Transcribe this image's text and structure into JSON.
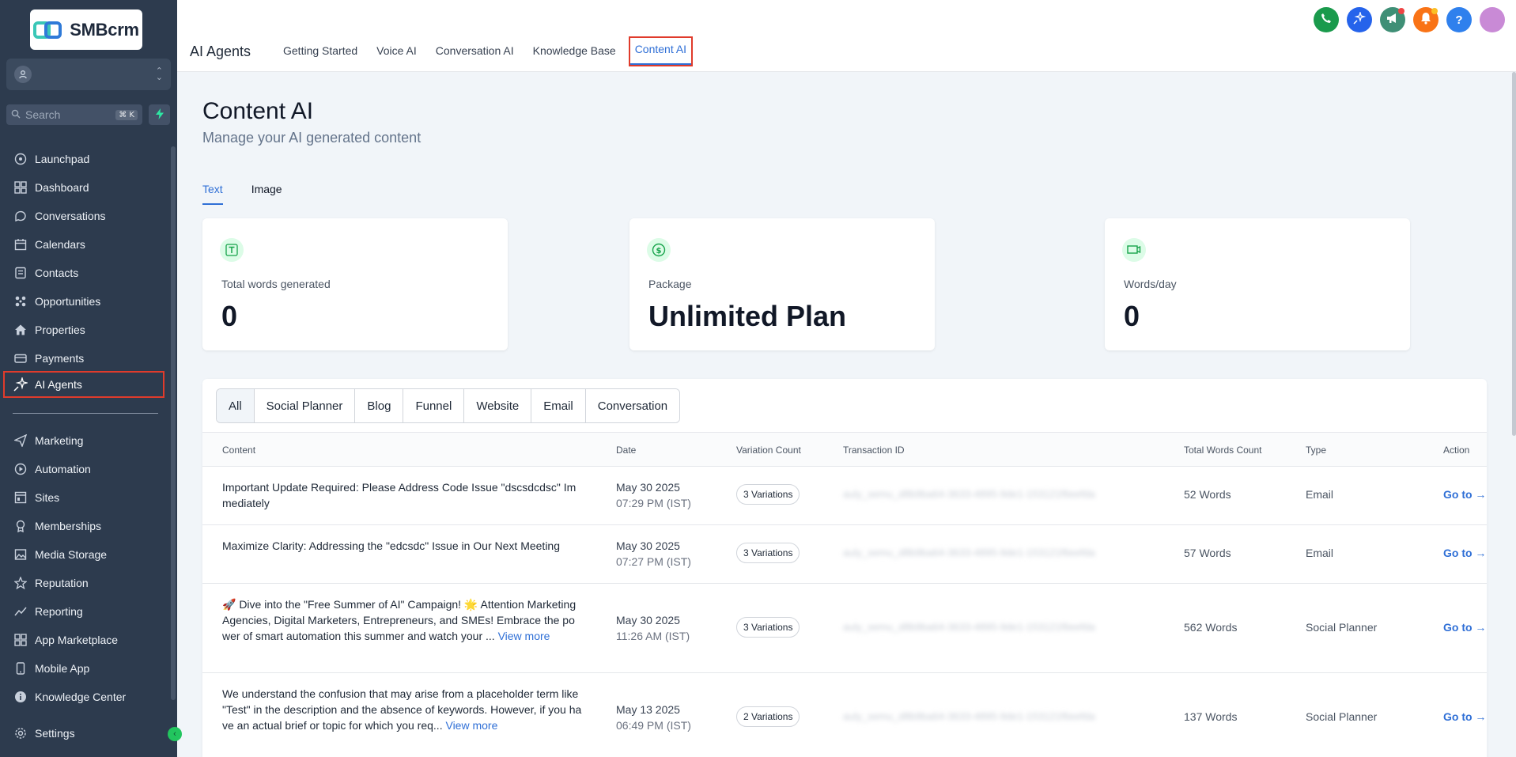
{
  "brand": {
    "name": "SMBcrm"
  },
  "sidebar": {
    "search_placeholder": "Search",
    "search_shortcut": "⌘ K",
    "items": [
      {
        "label": "Launchpad",
        "icon": "launchpad-icon"
      },
      {
        "label": "Dashboard",
        "icon": "dashboard-icon"
      },
      {
        "label": "Conversations",
        "icon": "chat-icon"
      },
      {
        "label": "Calendars",
        "icon": "calendar-icon"
      },
      {
        "label": "Contacts",
        "icon": "contacts-icon"
      },
      {
        "label": "Opportunities",
        "icon": "opportunities-icon"
      },
      {
        "label": "Properties",
        "icon": "home-icon"
      },
      {
        "label": "Payments",
        "icon": "payments-icon"
      },
      {
        "label": "AI Agents",
        "icon": "sparkle-icon"
      }
    ],
    "items2": [
      {
        "label": "Marketing",
        "icon": "send-icon"
      },
      {
        "label": "Automation",
        "icon": "automation-icon"
      },
      {
        "label": "Sites",
        "icon": "sites-icon"
      },
      {
        "label": "Memberships",
        "icon": "memberships-icon"
      },
      {
        "label": "Media Storage",
        "icon": "image-icon"
      },
      {
        "label": "Reputation",
        "icon": "star-icon"
      },
      {
        "label": "Reporting",
        "icon": "trend-icon"
      },
      {
        "label": "App Marketplace",
        "icon": "grid-icon"
      },
      {
        "label": "Mobile App",
        "icon": "mobile-icon"
      },
      {
        "label": "Knowledge Center",
        "icon": "info-icon"
      }
    ],
    "settings_label": "Settings"
  },
  "header": {
    "title": "AI Agents",
    "tabs": [
      "Getting Started",
      "Voice AI",
      "Conversation AI",
      "Knowledge Base",
      "Content AI"
    ],
    "active_tab": "Content AI"
  },
  "page": {
    "title": "Content AI",
    "subtitle": "Manage your AI generated content",
    "subtabs": [
      "Text",
      "Image"
    ],
    "active_subtab": "Text"
  },
  "stats": [
    {
      "label": "Total words generated",
      "value": "0",
      "icon": "text-icon"
    },
    {
      "label": "Package",
      "value": "Unlimited Plan",
      "icon": "dollar-icon"
    },
    {
      "label": "Words/day",
      "value": "0",
      "icon": "gauge-icon"
    }
  ],
  "filters": [
    "All",
    "Social Planner",
    "Blog",
    "Funnel",
    "Website",
    "Email",
    "Conversation"
  ],
  "active_filter": "All",
  "table": {
    "columns": [
      "Content",
      "Date",
      "Variation Count",
      "Transaction ID",
      "Total Words Count",
      "Type",
      "Action"
    ],
    "rows": [
      {
        "content": "Important Update Required: Please Address Code Issue \"dscsdcdsc\" Immediately",
        "view_more": "",
        "date": "May 30 2025",
        "time": "07:29 PM (IST)",
        "variations": "3 Variations",
        "txn": "auly_semu_d8b9ba64-3633-4895-9de1-153121f6eefda",
        "words": "52 Words",
        "type": "Email",
        "action": "Go to →"
      },
      {
        "content": "Maximize Clarity: Addressing the \"edcsdc\" Issue in Our Next Meeting",
        "view_more": "",
        "date": "May 30 2025",
        "time": "07:27 PM (IST)",
        "variations": "3 Variations",
        "txn": "auly_semu_d8b9ba64-3633-4895-9de1-153121f6eefda",
        "words": "57 Words",
        "type": "Email",
        "action": "Go to →"
      },
      {
        "content": "🚀 Dive into the \"Free Summer of AI\" Campaign! 🌟 Attention Marketing Agencies, Digital Marketers, Entrepreneurs, and SMEs! Embrace the power of smart automation this summer and watch your ... ",
        "view_more": "View more",
        "date": "May 30 2025",
        "time": "11:26 AM (IST)",
        "variations": "3 Variations",
        "txn": "auly_semu_d8b9ba64-3633-4895-9de1-153121f6eefda",
        "words": "562 Words",
        "type": "Social Planner",
        "action": "Go to →"
      },
      {
        "content": "We understand the confusion that may arise from a placeholder term like \"Test\" in the description and the absence of keywords. However, if you have an actual brief or topic for which you req... ",
        "view_more": "View more",
        "date": "May 13 2025",
        "time": "06:49 PM (IST)",
        "variations": "2 Variations",
        "txn": "auly_semu_d8b9ba64-3633-4895-9de1-153121f6eefda",
        "words": "137 Words",
        "type": "Social Planner",
        "action": "Go to →"
      }
    ]
  },
  "colors": {
    "sidebar_bg": "#2d3b4e",
    "accent": "#2f6fd6",
    "highlight": "#e03b2b"
  }
}
